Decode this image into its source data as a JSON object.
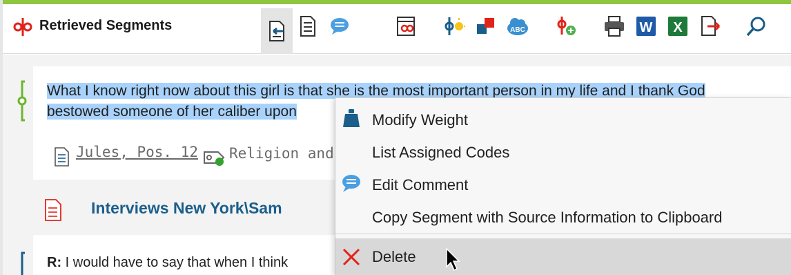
{
  "app": {
    "title": "Retrieved Segments"
  },
  "toolbar": {
    "buttons": [
      {
        "icon": "segment-doc-icon",
        "active": true
      },
      {
        "icon": "list-doc-icon"
      },
      {
        "icon": "comment-icon"
      },
      {
        "icon": "document-codes-icon"
      },
      {
        "icon": "code-lightbulb-icon"
      },
      {
        "icon": "color-squares-icon"
      },
      {
        "icon": "spell-cloud-icon",
        "text": "ABC"
      },
      {
        "icon": "add-code-icon"
      },
      {
        "icon": "print-icon"
      },
      {
        "icon": "word-export-icon",
        "text": "W"
      },
      {
        "icon": "excel-export-icon",
        "text": "X"
      },
      {
        "icon": "export-icon"
      },
      {
        "icon": "search-icon"
      }
    ]
  },
  "segment": {
    "line1": "What I know right now about this girl is that she is the most important person in my life and I thank God",
    "line2": "bestowed someone of her caliber upon",
    "source": "Jules, Pos. 12",
    "code": "Religion and"
  },
  "document_header": "Interviews New York\\Sam",
  "next_segment": {
    "speaker": "R:",
    "text": "I would have to say that when I think"
  },
  "context_menu": {
    "items": [
      {
        "label": "Modify Weight",
        "icon": "weight-icon"
      },
      {
        "label": "List Assigned Codes",
        "icon": ""
      },
      {
        "label": "Edit Comment",
        "icon": "comment-icon"
      },
      {
        "label": "Copy Segment with Source Information to Clipboard",
        "icon": ""
      },
      {
        "label": "Delete",
        "icon": "delete-x-icon",
        "hovered": true
      }
    ]
  },
  "colors": {
    "accent_green": "#8ec63f",
    "highlight_blue": "#a8d2fb",
    "header_blue": "#1b5e8b",
    "code_red": "#e2231a"
  }
}
